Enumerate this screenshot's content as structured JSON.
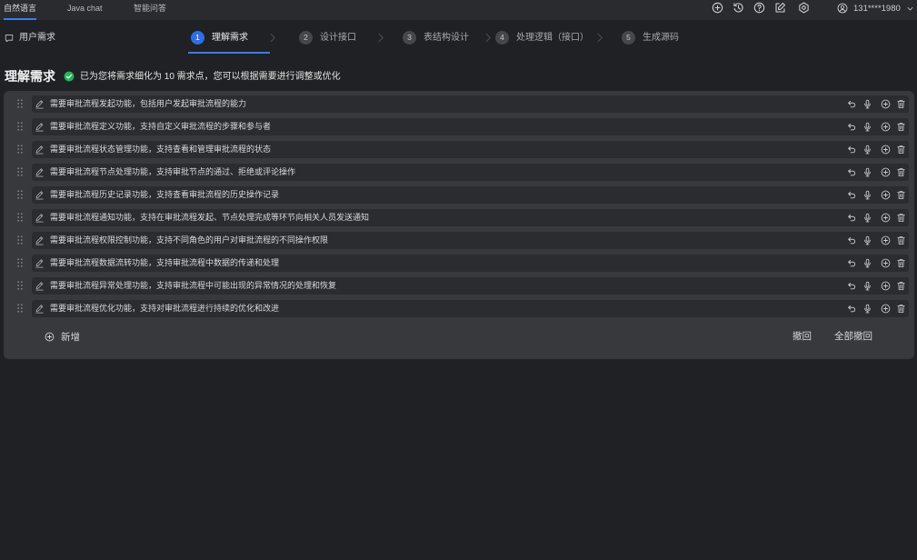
{
  "top_tabs": [
    {
      "label": "自然语言",
      "active": true
    },
    {
      "label": "Java chat",
      "active": false
    },
    {
      "label": "智能问答",
      "active": false
    }
  ],
  "top_actions": [
    "add-circle-icon",
    "history-icon",
    "help-icon",
    "edit-icon",
    "settings-icon"
  ],
  "user": {
    "icon": "user-circle-icon",
    "name": "131****1980"
  },
  "breadcrumb": {
    "icon": "message-icon",
    "label": "用户需求"
  },
  "steps": [
    {
      "number": "1",
      "label": "理解需求",
      "active": true
    },
    {
      "number": "2",
      "label": "设计接口",
      "active": false
    },
    {
      "number": "3",
      "label": "表结构设计",
      "active": false
    },
    {
      "number": "4",
      "label": "处理逻辑（接口）",
      "active": false
    },
    {
      "number": "5",
      "label": "生成源码",
      "active": false
    }
  ],
  "section": {
    "title": "理解需求",
    "status_icon": "check-circle-icon",
    "message": "已为您将需求细化为 10 需求点，您可以根据需要进行调整或优化"
  },
  "requirements": [
    "需要审批流程发起功能，包括用户发起审批流程的能力",
    "需要审批流程定义功能，支持自定义审批流程的步骤和参与者",
    "需要审批流程状态管理功能，支持查看和管理审批流程的状态",
    "需要审批流程节点处理功能，支持审批节点的通过、拒绝或评论操作",
    "需要审批流程历史记录功能，支持查看审批流程的历史操作记录",
    "需要审批流程通知功能，支持在审批流程发起、节点处理完成等环节向相关人员发送通知",
    "需要审批流程权限控制功能，支持不同角色的用户对审批流程的不同操作权限",
    "需要审批流程数据流转功能，支持审批流程中数据的传递和处理",
    "需要审批流程异常处理功能，支持审批流程中可能出现的异常情况的处理和恢复",
    "需要审批流程优化功能，支持对审批流程进行持续的优化和改进"
  ],
  "row_actions": [
    "undo-icon",
    "microphone-icon",
    "add-circle-icon",
    "trash-icon"
  ],
  "footer": {
    "add_label": "新增",
    "undo_label": "撤回",
    "undo_all_label": "全部撤回"
  },
  "colors": {
    "page_bg": "#202124",
    "topbar_bg": "#2a2b2f",
    "panel_bg": "#37393c",
    "row_bg": "#2a2c2f",
    "accent": "#2f6fe4",
    "success": "#22b357"
  }
}
